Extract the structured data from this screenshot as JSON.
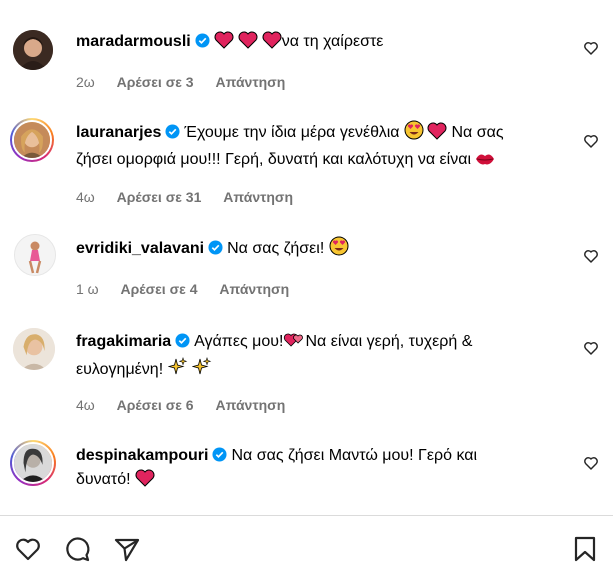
{
  "comments": [
    {
      "username": "maradarmousli",
      "text": "να τη χαίρεστε",
      "time": "2ω",
      "likes": "Αρέσει σε 3",
      "reply": "Απάντηση"
    },
    {
      "username": "lauranarjes",
      "text_line1": "Έχουμε την ίδια μέρα γενέθλια",
      "text_line1b": "Να σας",
      "text_line2": "ζήσει ομορφιά μου!!! Γερή, δυνατή και καλότυχη να είναι",
      "time": "4ω",
      "likes": "Αρέσει σε 31",
      "reply": "Απάντηση"
    },
    {
      "username": "evridiki_valavani",
      "text": "Να σας ζήσει!",
      "time": "1 ω",
      "likes": "Αρέσει σε 4",
      "reply": "Απάντηση"
    },
    {
      "username": "fragakimaria",
      "text_line1": "Αγάπες μου!",
      "text_line1b": "Να είναι γερή, τυχερή &",
      "text_line2": "ευλογημένη!",
      "time": "4ω",
      "likes": "Αρέσει σε 6",
      "reply": "Απάντηση"
    },
    {
      "username": "despinakampouri",
      "text_line1": "Να σας ζήσει Μαντώ μου! Γερό και",
      "text_line2": "δυνατό!"
    }
  ],
  "icons": {
    "verified": "verified-badge-icon",
    "like": "heart-outline-icon",
    "comment": "comment-bubble-icon",
    "share": "paper-plane-icon",
    "save": "bookmark-icon"
  },
  "colors": {
    "verified": "#0095f6",
    "meta_text": "#737373",
    "heart_emoji": "#e0245e"
  }
}
